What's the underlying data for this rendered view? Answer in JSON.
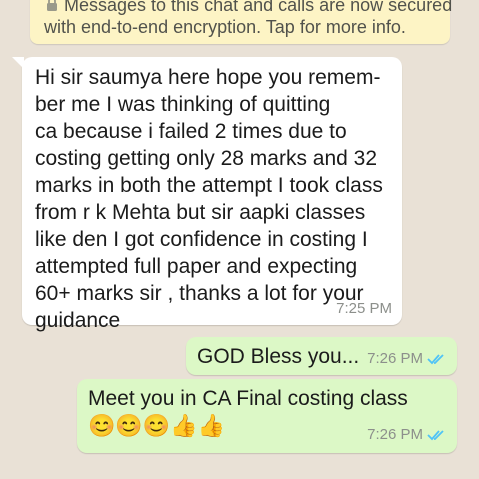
{
  "encryption_notice": {
    "line1": "Messages to this chat and calls are now secured",
    "line2": "with end-to-end encryption. Tap for more info."
  },
  "messages": [
    {
      "direction": "incoming",
      "text": "Hi sir saumya here hope you remem-\nber me I was thinking of quitting\nca because i failed 2 times due to\ncosting getting only 28 marks and 32\nmarks in both the attempt I took class\nfrom r k Mehta but sir aapki classes\nlike den I got confidence in costing I\nattempted full paper and expecting\n60+ marks sir , thanks a lot for your\nguidance",
      "time": "7:25 PM"
    },
    {
      "direction": "outgoing",
      "text": "GOD Bless you...",
      "time": "7:26 PM",
      "status": "read"
    },
    {
      "direction": "outgoing",
      "text": "Meet you in CA Final costing class",
      "emojis": "😊😊😊👍👍",
      "time": "7:26 PM",
      "status": "read"
    }
  ],
  "colors": {
    "chat_background": "#e9e1d6",
    "incoming_bubble": "#ffffff",
    "outgoing_bubble": "#dcf8c6",
    "notice_background": "#fdf4c5",
    "read_ticks": "#4fc3f7"
  }
}
